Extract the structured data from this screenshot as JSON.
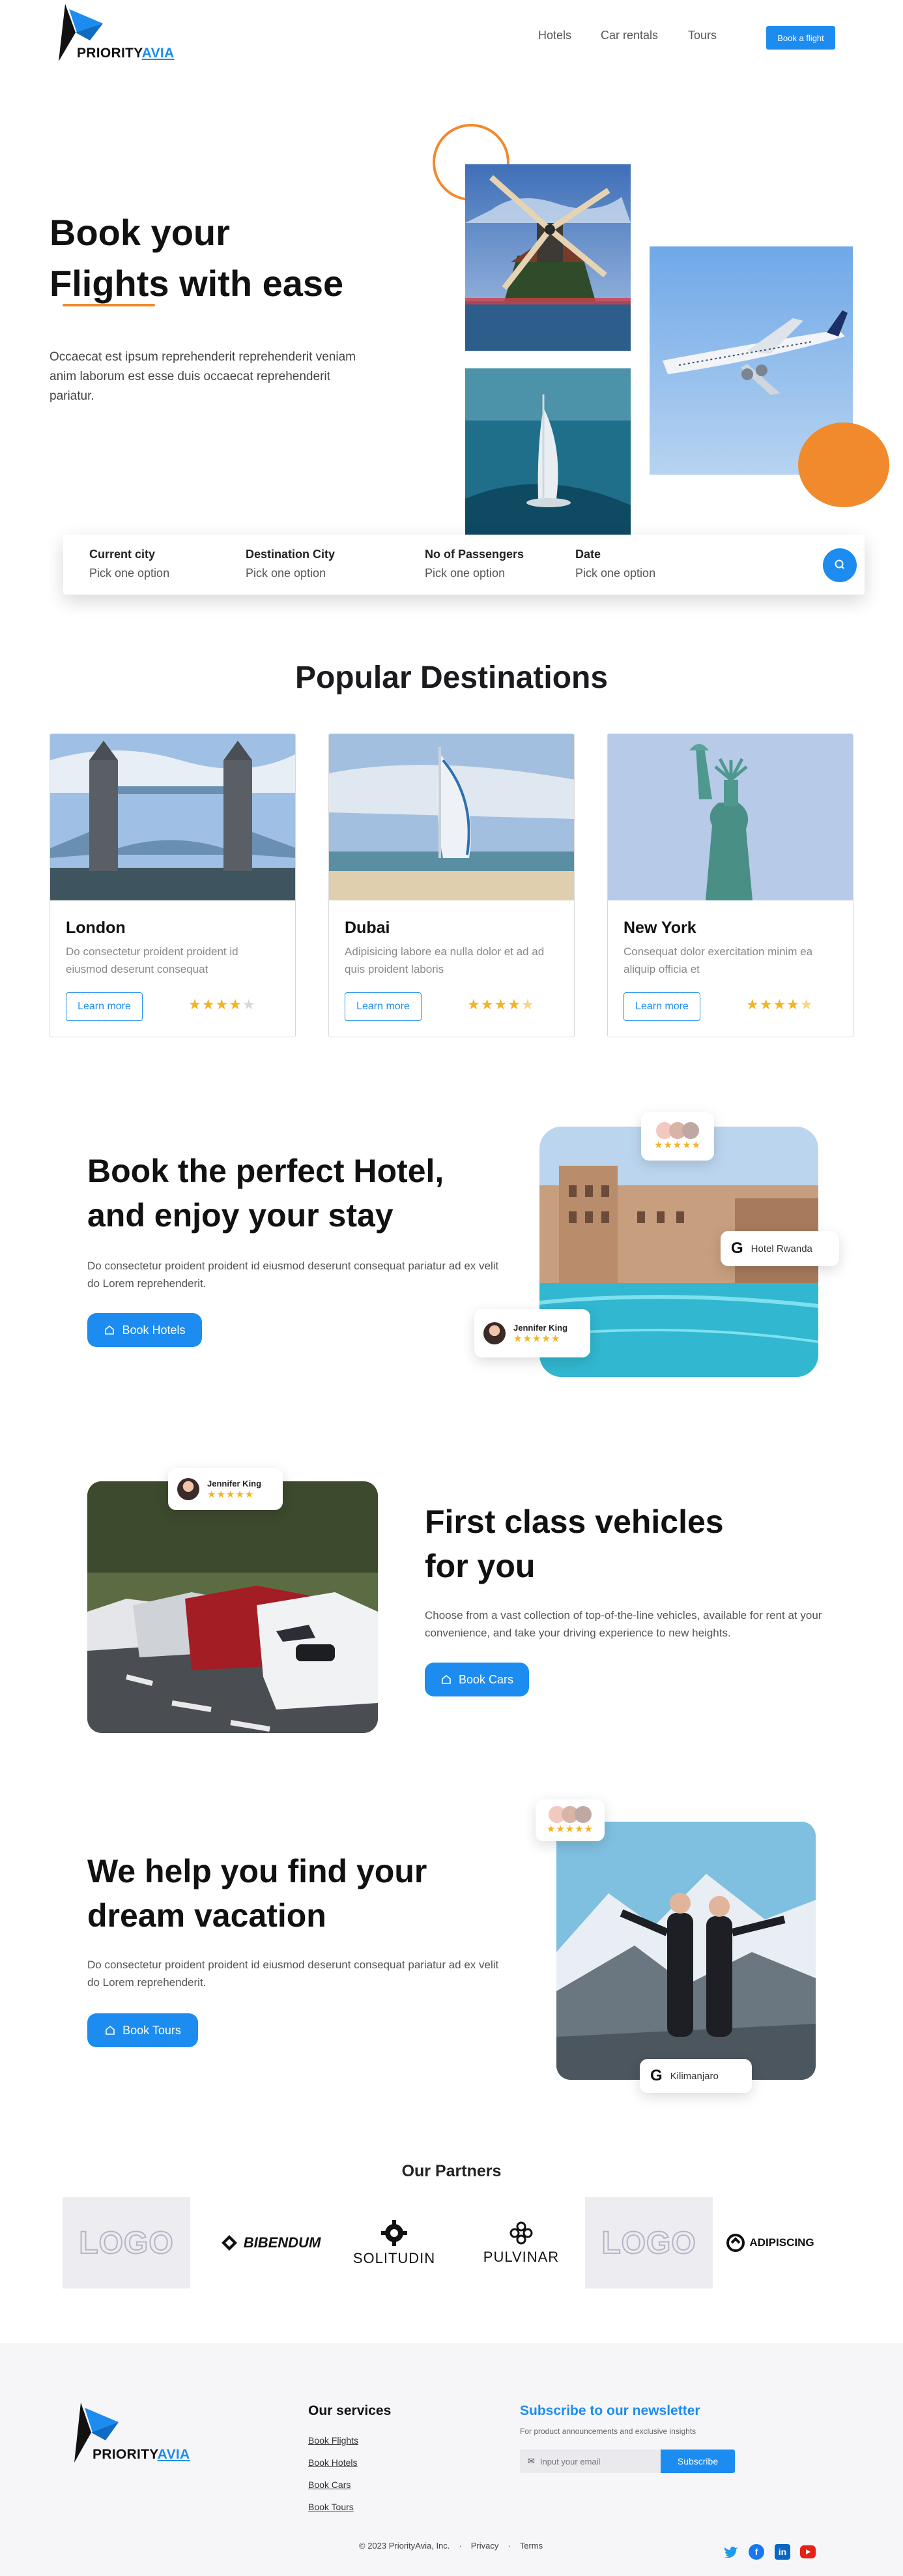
{
  "brand": {
    "name_part1": "PRIORITY",
    "name_part2": "AVIA"
  },
  "nav": {
    "links": [
      "Hotels",
      "Car rentals",
      "Tours"
    ],
    "cta": "Book a flight"
  },
  "hero": {
    "title_line1": "Book your",
    "title_line2": "Flights with ease",
    "text": "Occaecat est ipsum reprehenderit reprehenderit veniam anim laborum est esse duis occaecat reprehenderit pariatur."
  },
  "search": {
    "fields": [
      {
        "label": "Current city",
        "value": "Pick one option"
      },
      {
        "label": "Destination City",
        "value": "Pick one option"
      },
      {
        "label": "No of Passengers",
        "value": "Pick one option"
      },
      {
        "label": "Date",
        "value": "Pick one option"
      }
    ],
    "icon": "search-icon"
  },
  "destinations": {
    "title": "Popular Destinations",
    "cards": [
      {
        "name": "London",
        "desc": "Do consectetur proident proident id eiusmod deserunt consequat",
        "button": "Learn more",
        "rating": 4
      },
      {
        "name": "Dubai",
        "desc": "Adipisicing labore ea nulla dolor et ad ad quis proident laboris",
        "button": "Learn more",
        "rating": 4.5
      },
      {
        "name": "New York",
        "desc": "Consequat dolor exercitation minim ea aliquip officia et",
        "button": "Learn more",
        "rating": 4.5
      }
    ]
  },
  "hotels": {
    "title_line1": "Book the perfect Hotel,",
    "title_line2": "and enjoy your stay",
    "text": "Do consectetur proident proident id eiusmod deserunt consequat pariatur ad ex velit do Lorem reprehenderit.",
    "button": "Book Hotels",
    "badge_location": "Hotel Rwanda",
    "badge_reviewer": "Jennifer King",
    "badge_stars": "★★★★★"
  },
  "cars": {
    "title_line1": "First class vehicles",
    "title_line2": "for you",
    "text": "Choose from a vast collection of top-of-the-line vehicles, available for rent at your convenience, and take your driving experience to new heights.",
    "button": "Book Cars",
    "badge_reviewer": "Jennifer King",
    "badge_stars": "★★★★★"
  },
  "tours": {
    "title_line1": "We help you find your",
    "title_line2": "dream vacation",
    "text": "Do consectetur proident proident id eiusmod deserunt consequat pariatur ad ex velit do Lorem reprehenderit.",
    "button": "Book Tours",
    "badge_location": "Kilimanjaro",
    "badge_stars": "★★★★★"
  },
  "partners": {
    "title": "Our Partners",
    "logos": [
      "LOGO",
      "BIBENDUM",
      "SOLITUDIN",
      "PULVINAR",
      "LOGO",
      "ADIPISCING"
    ]
  },
  "footer": {
    "services_title": "Our services",
    "services": [
      "Book Flights",
      "Book Hotels",
      "Book Cars",
      "Book Tours"
    ],
    "newsletter_title": "Subscribe to our newsletter",
    "newsletter_text": "For product announcements and exclusive insights",
    "email_placeholder": "Input your email",
    "subscribe": "Subscribe",
    "copyright": "© 2023 PriorityAvia, Inc.",
    "links": [
      "Privacy",
      "Terms"
    ],
    "separator": "·",
    "social": [
      "twitter-icon",
      "facebook-icon",
      "linkedin-icon",
      "youtube-icon"
    ]
  },
  "colors": {
    "accent": "#1d8cf0",
    "orange": "#f08a2c",
    "star": "#f2b325"
  }
}
